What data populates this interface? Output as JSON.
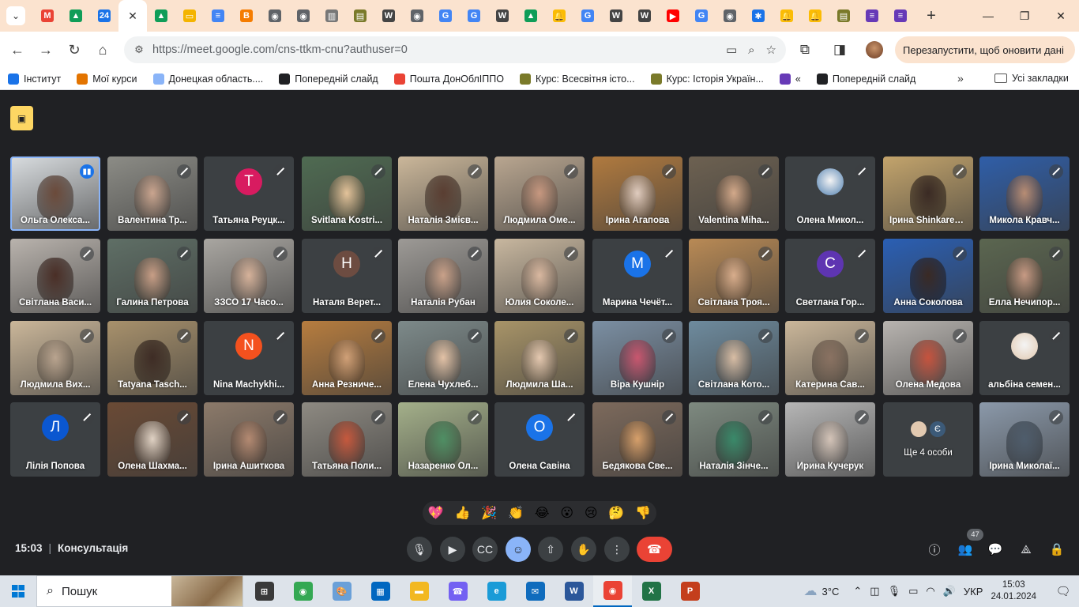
{
  "browser": {
    "url_host": "https://meet.google.com",
    "url_path": "/cns-ttkm-cnu?authuser=0",
    "update_button": "Перезапустити, щоб оновити дані",
    "tabs": [
      {
        "fav": "M",
        "color": "#ea4335"
      },
      {
        "fav": "▲",
        "color": "#0f9d58"
      },
      {
        "fav": "24",
        "color": "#1a73e8"
      },
      {
        "fav": "active",
        "color": "#fff"
      },
      {
        "fav": "▲",
        "color": "#0f9d58"
      },
      {
        "fav": "▭",
        "color": "#f4b400"
      },
      {
        "fav": "≡",
        "color": "#4285f4"
      },
      {
        "fav": "B",
        "color": "#f57c00"
      },
      {
        "fav": "◉",
        "color": "#5f6368"
      },
      {
        "fav": "◉",
        "color": "#5f6368"
      },
      {
        "fav": "▥",
        "color": "#777"
      },
      {
        "fav": "▤",
        "color": "#7a7a2a"
      },
      {
        "fav": "W",
        "color": "#444"
      },
      {
        "fav": "◉",
        "color": "#5f6368"
      },
      {
        "fav": "G",
        "color": "#4285f4"
      },
      {
        "fav": "G",
        "color": "#4285f4"
      },
      {
        "fav": "W",
        "color": "#444"
      },
      {
        "fav": "▲",
        "color": "#0f9d58"
      },
      {
        "fav": "🔔",
        "color": "#fbbc04"
      },
      {
        "fav": "G",
        "color": "#4285f4"
      },
      {
        "fav": "W",
        "color": "#444"
      },
      {
        "fav": "W",
        "color": "#444"
      },
      {
        "fav": "▶",
        "color": "#ff0000"
      },
      {
        "fav": "G",
        "color": "#4285f4"
      },
      {
        "fav": "◉",
        "color": "#5f6368"
      },
      {
        "fav": "✱",
        "color": "#1a73e8"
      },
      {
        "fav": "🔔",
        "color": "#fbbc04"
      },
      {
        "fav": "🔔",
        "color": "#fbbc04"
      },
      {
        "fav": "▤",
        "color": "#7a7a2a"
      },
      {
        "fav": "≡",
        "color": "#673ab7"
      },
      {
        "fav": "≡",
        "color": "#673ab7"
      }
    ],
    "bookmarks": [
      {
        "label": "Інститут",
        "color": "#1a73e8"
      },
      {
        "label": "Мої курси",
        "color": "#e37400"
      },
      {
        "label": "Донецкая область....",
        "color": "#8ab4f8"
      },
      {
        "label": "Попередній слайд",
        "color": "#202124"
      },
      {
        "label": "Пошта ДонОблІППО",
        "color": "#ea4335"
      },
      {
        "label": "Курс: Всесвітня істо...",
        "color": "#7a7a2a"
      },
      {
        "label": "Курс: Історія Україн...",
        "color": "#7a7a2a"
      },
      {
        "label": "«",
        "color": "#673ab7"
      },
      {
        "label": "Попередній слайд",
        "color": "#202124"
      }
    ],
    "bookmarks_all": "Усі закладки"
  },
  "meet": {
    "time": "15:03",
    "meeting_name": "Консультація",
    "participant_count": "47",
    "more_people": "Ще 4 особи",
    "more_initial": "Є",
    "reactions": [
      "💖",
      "👍",
      "🎉",
      "👏",
      "😂",
      "😮",
      "😢",
      "🤔",
      "👎"
    ],
    "participants": [
      {
        "name": "Ольга Олекса...",
        "kind": "video",
        "bg": "#d9dde0",
        "face": "#6b4a3a",
        "speaking": true
      },
      {
        "name": "Валентина Тр...",
        "kind": "video",
        "bg": "#8c8c86",
        "face": "#caa58f"
      },
      {
        "name": "Татьяна Реуцк...",
        "kind": "initial",
        "initial": "Т",
        "color": "#d81b60"
      },
      {
        "name": "Svitlana Kostri...",
        "kind": "video",
        "bg": "#4f6b52",
        "face": "#e4c39a"
      },
      {
        "name": "Наталія Змієв...",
        "kind": "video",
        "bg": "#cbb79a",
        "face": "#5a3e32"
      },
      {
        "name": "Людмила Оме...",
        "kind": "video",
        "bg": "#b9a690",
        "face": "#c79880"
      },
      {
        "name": "Ірина Агапова",
        "kind": "video",
        "bg": "#b07a3f",
        "face": "#e0ccbf"
      },
      {
        "name": "Valentina Miha...",
        "kind": "video",
        "bg": "#6d6151",
        "face": "#d3a98a"
      },
      {
        "name": "Олена Микол...",
        "kind": "photo",
        "photo": "#4f7fb0"
      },
      {
        "name": "Ірина Shinkaren...",
        "kind": "video",
        "bg": "#c3a46c",
        "face": "#3a2a24"
      },
      {
        "name": "Микола Кравч...",
        "kind": "video",
        "bg": "#2f5ea8",
        "face": "#b88d74"
      },
      {
        "name": "Світлана Васи...",
        "kind": "video",
        "bg": "#b9b3ad",
        "face": "#4a2e26"
      },
      {
        "name": "Галина Петрова",
        "kind": "video",
        "bg": "#5f6f66",
        "face": "#c89e86"
      },
      {
        "name": "ЗЗСО 17 Часо...",
        "kind": "video",
        "bg": "#a9a6a1",
        "face": "#d6b29a"
      },
      {
        "name": "Наталя Верет...",
        "kind": "initial",
        "initial": "Н",
        "color": "#6d4c41"
      },
      {
        "name": "Наталія Рубан",
        "kind": "video",
        "bg": "#9d9a96",
        "face": "#c9a189"
      },
      {
        "name": "Юлия Соколе...",
        "kind": "video",
        "bg": "#c8b79f",
        "face": "#d9b8a0"
      },
      {
        "name": "Марина Чечёт...",
        "kind": "initial",
        "initial": "М",
        "color": "#1a73e8"
      },
      {
        "name": "Світлана Троя...",
        "kind": "video",
        "bg": "#b98a55",
        "face": "#d8ad8c"
      },
      {
        "name": "Светлана Гор...",
        "kind": "initial",
        "initial": "С",
        "color": "#5e35b1"
      },
      {
        "name": "Анна Соколова",
        "kind": "video",
        "bg": "#2a5fb4",
        "face": "#3a2a24"
      },
      {
        "name": "Елла Нечипор...",
        "kind": "video",
        "bg": "#5b6650",
        "face": "#c79a84"
      },
      {
        "name": "Людмила Вих...",
        "kind": "video",
        "bg": "#cbb79a",
        "face": "#b9a48f"
      },
      {
        "name": "Tatyana Tasch...",
        "kind": "video",
        "bg": "#a8916c",
        "face": "#3e2c25"
      },
      {
        "name": "Nina Machykhi...",
        "kind": "initial",
        "initial": "N",
        "color": "#f4511e"
      },
      {
        "name": "Анна Резниче...",
        "kind": "video",
        "bg": "#b77d3f",
        "face": "#d0a077"
      },
      {
        "name": "Елена Чухлеб...",
        "kind": "video",
        "bg": "#7d8a8a",
        "face": "#e3c2a6"
      },
      {
        "name": "Людмила Ша...",
        "kind": "video",
        "bg": "#a89468",
        "face": "#e4c8b0"
      },
      {
        "name": "Віра Кушнір",
        "kind": "video",
        "bg": "#7b8fa3",
        "face": "#c9576f"
      },
      {
        "name": "Світлана Кото...",
        "kind": "video",
        "bg": "#6e8b9e",
        "face": "#d8bda4"
      },
      {
        "name": "Катерина Сав...",
        "kind": "video",
        "bg": "#cbb79a",
        "face": "#8a7262"
      },
      {
        "name": "Олена Медова",
        "kind": "video",
        "bg": "#b8b4b0",
        "face": "#c6533e"
      },
      {
        "name": "альбіна семен...",
        "kind": "photo",
        "photo": "#e2c9b0"
      },
      {
        "name": "Лілія Попова",
        "kind": "initial",
        "initial": "Л",
        "color": "#0b57d0"
      },
      {
        "name": "Олена Шахма...",
        "kind": "video",
        "bg": "#6a4a35",
        "face": "#e0d2c4"
      },
      {
        "name": "Ірина Ашиткова",
        "kind": "video",
        "bg": "#8c7a6a",
        "face": "#b48a72"
      },
      {
        "name": "Татьяна Поли...",
        "kind": "video",
        "bg": "#8e8a82",
        "face": "#c6593e"
      },
      {
        "name": "Назаренко Ол...",
        "kind": "video",
        "bg": "#a4b08a",
        "face": "#4f8f64"
      },
      {
        "name": "Олена Савіна",
        "kind": "initial",
        "initial": "О",
        "color": "#1a73e8"
      },
      {
        "name": "Бедякова Све...",
        "kind": "video",
        "bg": "#7d6a5c",
        "face": "#d7a06b"
      },
      {
        "name": "Наталія Зінче...",
        "kind": "video",
        "bg": "#7e8a80",
        "face": "#3a8a6a"
      },
      {
        "name": "Ирина Кучерук",
        "kind": "video",
        "bg": "#b6b6b6",
        "face": "#d4c4b8"
      },
      {
        "name": "Ірина Миколаї...",
        "kind": "video",
        "bg": "#8b99aa",
        "face": "#4f5d6c"
      }
    ]
  },
  "taskbar": {
    "search_label": "Пошук",
    "weather": "3°C",
    "language": "УКР",
    "time": "15:03",
    "date": "24.01.2024",
    "apps": [
      {
        "name": "task-view",
        "icon": "⊞",
        "color": "#3a3a3a"
      },
      {
        "name": "chrome",
        "icon": "◉",
        "color": "#34a853"
      },
      {
        "name": "paint",
        "icon": "🎨",
        "color": "#6aa0d8"
      },
      {
        "name": "store",
        "icon": "▦",
        "color": "#0067c0"
      },
      {
        "name": "explorer",
        "icon": "▬",
        "color": "#f2b821"
      },
      {
        "name": "viber",
        "icon": "☎",
        "color": "#7360f2"
      },
      {
        "name": "edge",
        "icon": "e",
        "color": "#1a9bd7"
      },
      {
        "name": "mail",
        "icon": "✉",
        "color": "#0f6cbd"
      },
      {
        "name": "word",
        "icon": "W",
        "color": "#2b579a"
      },
      {
        "name": "chrome-running",
        "icon": "◉",
        "color": "#ea4335"
      },
      {
        "name": "excel",
        "icon": "X",
        "color": "#217346"
      },
      {
        "name": "powerpoint",
        "icon": "P",
        "color": "#c43e1c"
      }
    ]
  }
}
